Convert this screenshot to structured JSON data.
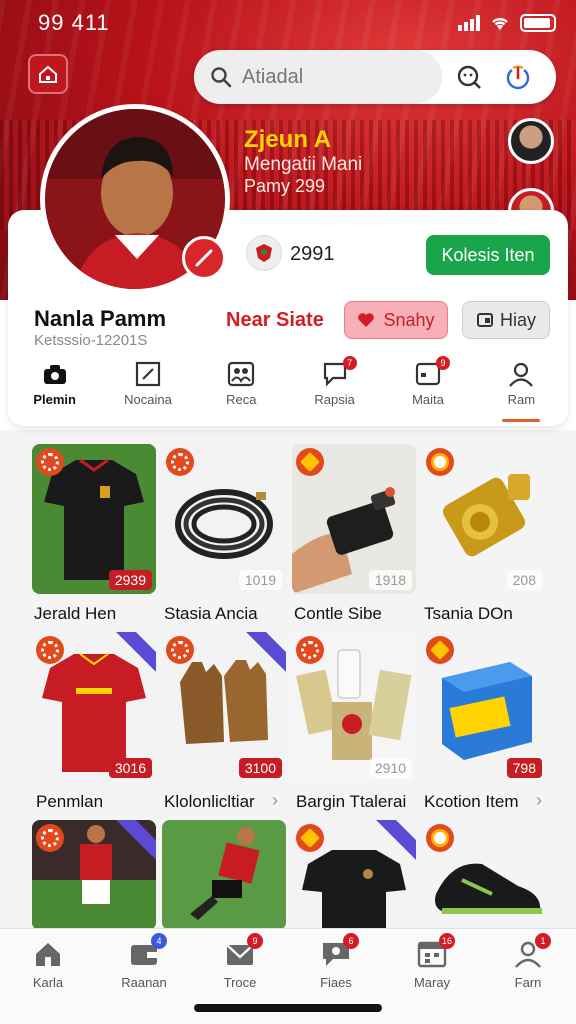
{
  "status_bar": {
    "time": "99 411"
  },
  "search": {
    "placeholder": "Atiadal"
  },
  "hero": {
    "name": "Zjeun A",
    "subtitle": "Mengatii Mani",
    "meta": "Pamy 299"
  },
  "club": {
    "count": "2991"
  },
  "follow_button": "Kolesis Iten",
  "user": {
    "name": "Nanla Pamm",
    "id": "Ketsssio-12201S"
  },
  "near_state": "Near Siate",
  "buttons": {
    "snap": "Snahy",
    "hiay": "Hiay"
  },
  "profile_tabs": [
    {
      "label": "Plemin",
      "icon": "camera-icon",
      "active": true
    },
    {
      "label": "Nocaina",
      "icon": "resize-icon"
    },
    {
      "label": "Reca",
      "icon": "people-icon"
    },
    {
      "label": "Rapsia",
      "icon": "chat-icon",
      "badge": "7"
    },
    {
      "label": "Maita",
      "icon": "box-icon",
      "badge": "9"
    },
    {
      "label": "Ram",
      "icon": "user-icon",
      "underline": true
    }
  ],
  "products": [
    {
      "name": "Jerald Hen",
      "price": "2939",
      "price_style": "red",
      "badge": "ring",
      "image": "jersey-black"
    },
    {
      "name": "Stasia Ancia",
      "price": "1019",
      "price_style": "grey",
      "badge": "ring",
      "image": "cable"
    },
    {
      "name": "Contle Sibe",
      "price": "1918",
      "price_style": "grey",
      "badge": "yellow",
      "image": "device"
    },
    {
      "name": "Tsania DOn",
      "price": "208",
      "price_style": "grey",
      "badge": "orange",
      "image": "gold-item"
    },
    {
      "name": "Penmlan",
      "price": "3016",
      "price_style": "red",
      "badge": "ring",
      "image": "jersey-red"
    },
    {
      "name": "Klolonlicltiar",
      "price": "3100",
      "price_style": "red",
      "badge": "ring",
      "image": "gloves"
    },
    {
      "name": "Bargin Ttalerai",
      "price": "2910",
      "price_style": "grey",
      "badge": "ring",
      "image": "snacks"
    },
    {
      "name": "Kcotion Item",
      "price": "798",
      "price_style": "red",
      "badge": "yellow",
      "image": "box"
    },
    {
      "name": "",
      "price": "",
      "badge": "ring",
      "image": "player-photo"
    },
    {
      "name": "",
      "price": "",
      "badge": "",
      "image": "player-action"
    },
    {
      "name": "",
      "price": "",
      "badge": "yellow",
      "image": "jersey-black2"
    },
    {
      "name": "",
      "price": "",
      "badge": "orange",
      "image": "shoe"
    }
  ],
  "bottom_nav": [
    {
      "label": "Karla",
      "icon": "home-icon"
    },
    {
      "label": "Raanan",
      "icon": "wallet-icon",
      "badge": "4",
      "badge_color": "blue"
    },
    {
      "label": "Troce",
      "icon": "mail-icon",
      "badge": "9"
    },
    {
      "label": "Fiaes",
      "icon": "chat-icon",
      "badge": "6"
    },
    {
      "label": "Maray",
      "icon": "calendar-icon",
      "badge": "16"
    },
    {
      "label": "Farn",
      "icon": "user-icon",
      "badge": "1"
    }
  ],
  "colors": {
    "primary_red": "#d41c24",
    "green": "#19a64a",
    "accent_orange": "#e24a1e"
  }
}
